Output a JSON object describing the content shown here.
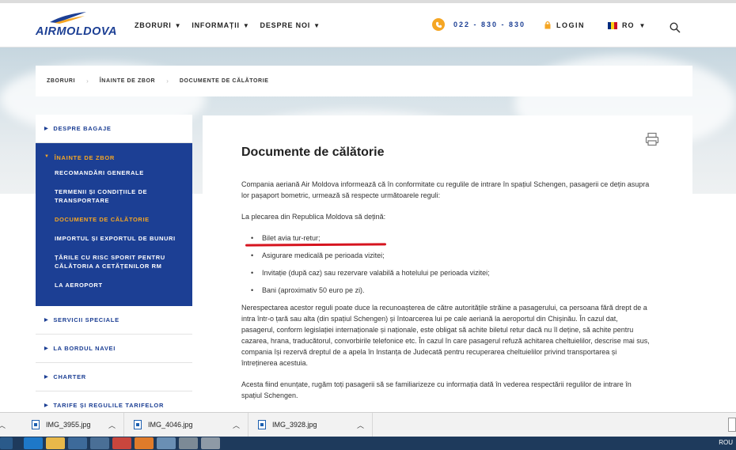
{
  "header": {
    "logo_text": "AIRMOLDOVA",
    "nav": [
      {
        "label": "ZBORURI"
      },
      {
        "label": "INFORMAȚII"
      },
      {
        "label": "DESPRE NOI"
      }
    ],
    "phone": "022 - 830 - 830",
    "login": "LOGIN",
    "lang": "RO"
  },
  "breadcrumb": [
    "ZBORURI",
    "ÎNAINTE DE ZBOR",
    "DOCUMENTE DE CĂLĂTORIE"
  ],
  "sidebar": {
    "top_item": "DESPRE BAGAJE",
    "active_header": "ÎNAINTE DE ZBOR",
    "sub_items": [
      "RECOMANDĂRI GENERALE",
      "TERMENII ȘI CONDIȚIILE DE TRANSPORTARE",
      "DOCUMENTE DE CĂLĂTORIE",
      "IMPORTUL ȘI EXPORTUL DE BUNURI",
      "ȚĂRILE CU RISC SPORIT PENTRU CĂLĂTORIA A CETĂȚENILOR RM",
      "LA AEROPORT"
    ],
    "bottom_items": [
      "SERVICII SPECIALE",
      "LA BORDUL NAVEI",
      "CHARTER",
      "TARIFE ȘI REGULILE TARIFELOR"
    ]
  },
  "content": {
    "title": "Documente de călătorie",
    "para1": "Compania aeriană Air Moldova informează că în conformitate cu regulile de intrare în spațiul Schengen, pasagerii ce dețin asupra lor pașaport bometric, urmează să respecte următoarele reguli:",
    "para2": "La plecarea din Republica Moldova să dețină:",
    "list": [
      "Bilet avia tur-retur;",
      "Asigurare medicală pe perioada vizitei;",
      "Invitație (după caz) sau rezervare valabilă a hotelului pe perioada vizitei;",
      "Bani (aproximativ 50 euro pe zi)."
    ],
    "para3": "Nerespectarea acestor reguli poate duce la recunoașterea de către autoritățile străine a pasagerului, ca persoana fără drept de a intra într-o țară sau alta (din spațiul Schengen) și întoarcerea lui pe cale aeriană la aeroportul din Chișinău. În cazul dat, pasagerul, conform legislației internaționale și naționale, este obligat să achite biletul retur dacă nu îl deține, să achite pentru cazarea, hrana, traducătorul, convorbirile telefonice etc. În cazul în care pasagerul refuză achitarea cheltuielilor, descrise mai sus, compania își rezervă dreptul de a apela în Instanța de Judecată pentru recuperarea cheltuielilor privind transportarea și întreținerea acestuia.",
    "para4": "Acesta fiind enunțate, rugăm toți pasagerii să se familiarizeze cu informația dată în vederea respectării regulilor de intrare în spațiul Schengen."
  },
  "downloads": [
    "IMG_3955.jpg",
    "IMG_4046.jpg",
    "IMG_3928.jpg"
  ],
  "taskbar": {
    "tray_text": "ROU"
  },
  "colors": {
    "brand_blue": "#1c3f94",
    "accent_orange": "#f5a623",
    "highlight_red": "#d6141f"
  }
}
